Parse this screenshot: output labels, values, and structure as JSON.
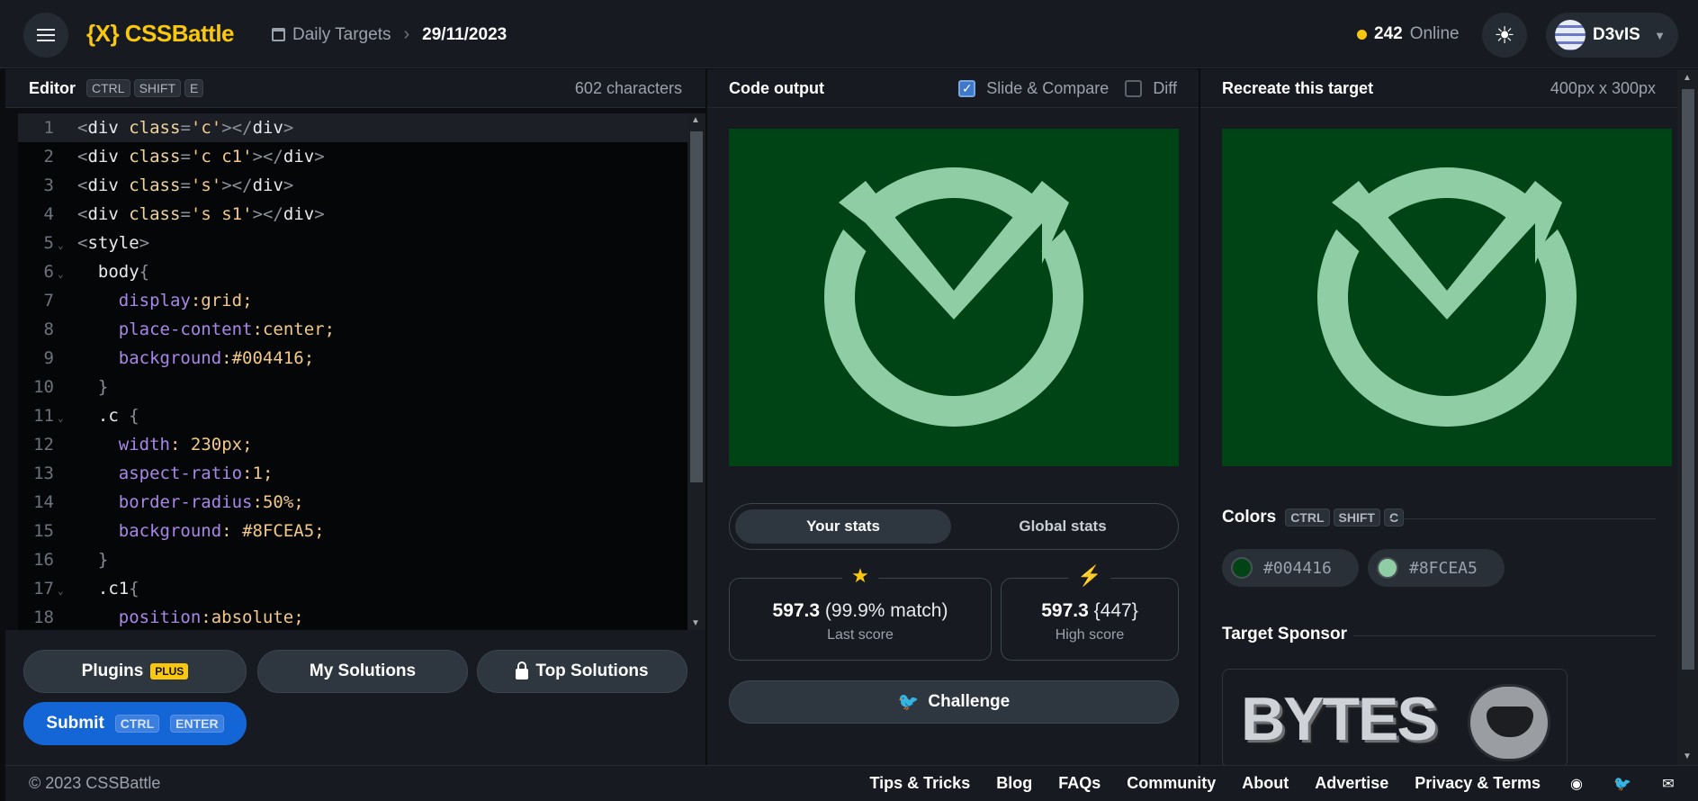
{
  "header": {
    "menu_icon": "hamburger-icon",
    "logo": "{X} CSSBattle",
    "breadcrumb_parent": "Daily Targets",
    "breadcrumb_current": "29/11/2023",
    "online_count": "242",
    "online_label": "Online",
    "theme_icon": "sun-icon",
    "username": "D3vIS"
  },
  "editor": {
    "title": "Editor",
    "shortcut": [
      "CTRL",
      "SHIFT",
      "E"
    ],
    "char_count": "602 characters",
    "lines": [
      {
        "n": "1",
        "text": "<div class='c'></div>",
        "active": true
      },
      {
        "n": "2",
        "text": "<div class='c c1'></div>"
      },
      {
        "n": "3",
        "text": "<div class='s'></div>"
      },
      {
        "n": "4",
        "text": "<div class='s s1'></div>"
      },
      {
        "n": "5",
        "text": "<style>",
        "fold": true
      },
      {
        "n": "6",
        "text": "  body{",
        "fold": true
      },
      {
        "n": "7",
        "text": "    display:grid;"
      },
      {
        "n": "8",
        "text": "    place-content:center;"
      },
      {
        "n": "9",
        "text": "    background:#004416;"
      },
      {
        "n": "10",
        "text": "  }"
      },
      {
        "n": "11",
        "text": "  .c {",
        "fold": true
      },
      {
        "n": "12",
        "text": "    width: 230px;"
      },
      {
        "n": "13",
        "text": "    aspect-ratio:1;"
      },
      {
        "n": "14",
        "text": "    border-radius:50%;"
      },
      {
        "n": "15",
        "text": "    background: #8FCEA5;"
      },
      {
        "n": "16",
        "text": "  }"
      },
      {
        "n": "17",
        "text": "  .c1{",
        "fold": true
      },
      {
        "n": "18",
        "text": "    position:absolute;"
      }
    ]
  },
  "buttons": {
    "plugins": "Plugins",
    "plugins_badge": "PLUS",
    "my_solutions": "My Solutions",
    "top_solutions": "Top Solutions",
    "submit": "Submit",
    "submit_shortcut": [
      "CTRL",
      "ENTER"
    ]
  },
  "output": {
    "title": "Code output",
    "slide_compare": "Slide & Compare",
    "slide_compare_checked": true,
    "diff": "Diff",
    "diff_checked": false
  },
  "stats": {
    "tab_yours": "Your stats",
    "tab_global": "Global stats",
    "last_score": "597.3",
    "last_match": "(99.9% match)",
    "last_label": "Last score",
    "high_score": "597.3",
    "high_chars": "{447}",
    "high_label": "High score",
    "challenge": "Challenge"
  },
  "target": {
    "title": "Recreate this target",
    "size": "400px x 300px",
    "colors_label": "Colors",
    "colors_shortcut": [
      "CTRL",
      "SHIFT",
      "C"
    ],
    "colors": [
      {
        "hex": "#004416"
      },
      {
        "hex": "#8FCEA5"
      }
    ],
    "sponsor_label": "Target Sponsor",
    "sponsor_logo_text": "BYTES"
  },
  "footer": {
    "copyright": "© 2023 CSSBattle",
    "links": [
      "Tips & Tricks",
      "Blog",
      "FAQs",
      "Community",
      "About",
      "Advertise",
      "Privacy & Terms"
    ],
    "icons": [
      "discord-icon",
      "twitter-icon",
      "mail-icon"
    ]
  },
  "theme": {
    "accent": "#F9C80E",
    "submit": "#1466D6",
    "bg_dark": "#004416",
    "fg_green": "#8FCEA5"
  }
}
